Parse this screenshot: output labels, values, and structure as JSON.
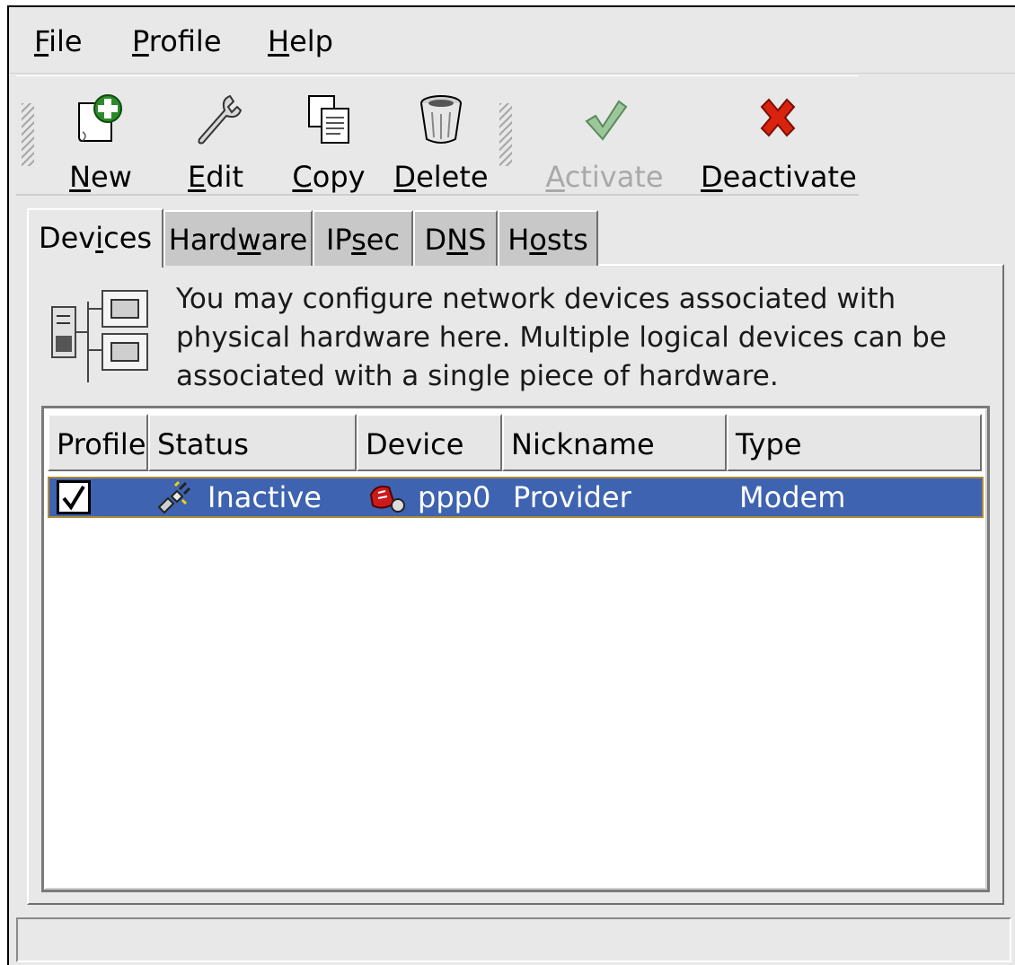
{
  "menubar": {
    "file": "File",
    "profile": "Profile",
    "help": "Help"
  },
  "toolbar": {
    "new": "New",
    "edit": "Edit",
    "copy": "Copy",
    "delete": "Delete",
    "activate": "Activate",
    "deactivate": "Deactivate",
    "activate_enabled": false
  },
  "tabs": [
    {
      "label": "Devices",
      "active": true
    },
    {
      "label": "Hardware",
      "active": false
    },
    {
      "label": "IPsec",
      "active": false
    },
    {
      "label": "DNS",
      "active": false
    },
    {
      "label": "Hosts",
      "active": false
    }
  ],
  "devices_panel": {
    "description": "You may configure network devices associated with physical hardware here.  Multiple logical devices can be associated with a single piece of hardware.",
    "columns": [
      "Profile",
      "Status",
      "Device",
      "Nickname",
      "Type"
    ],
    "rows": [
      {
        "profile_checked": true,
        "status": "Inactive",
        "device": "ppp0",
        "nickname": "Provider",
        "type": "Modem",
        "selected": true
      }
    ]
  },
  "statusbar": {
    "text": ""
  },
  "colors": {
    "window_bg": "#e8e8e8",
    "selection_bg": "#3e63b0",
    "selection_border": "#ad8a36",
    "delete_red": "#d9230f",
    "activate_green": "#3c8c3c"
  }
}
